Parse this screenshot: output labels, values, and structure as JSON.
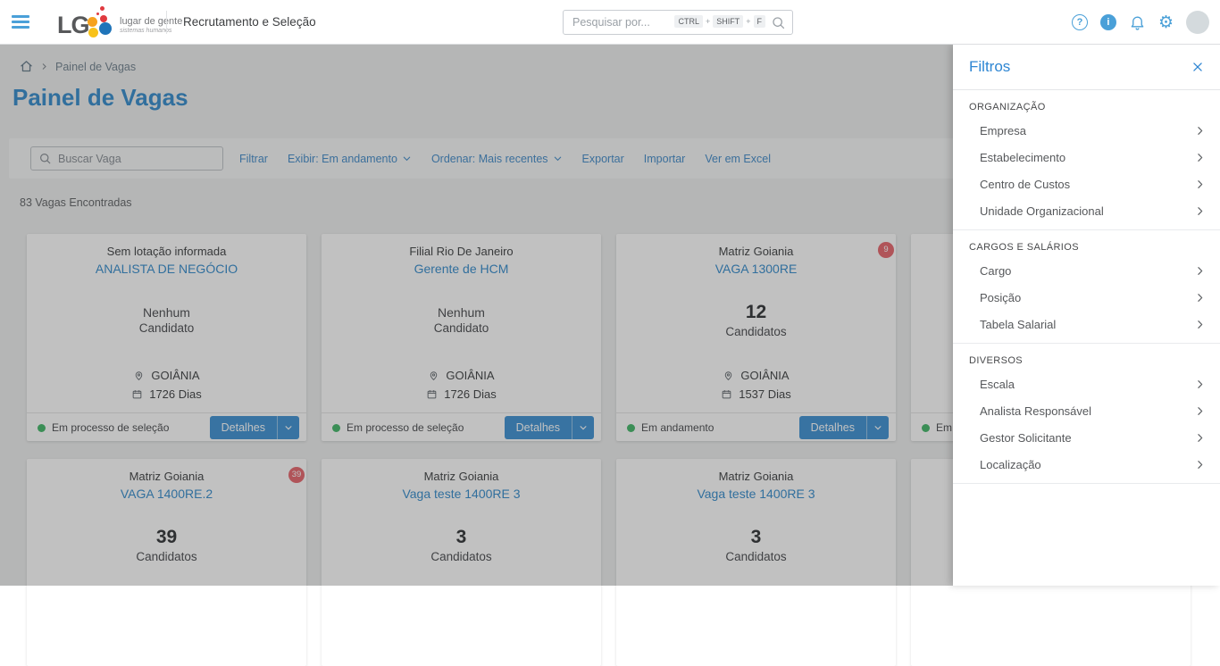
{
  "header": {
    "logo": {
      "lg": "LG",
      "tagline": "lugar de gente",
      "subtitle": "sistemas humanos"
    },
    "app_title": "Recrutamento e Seleção",
    "search": {
      "placeholder": "Pesquisar por...",
      "keys": [
        "CTRL",
        "SHIFT",
        "F"
      ],
      "separator": "+"
    },
    "glyphs": {
      "help": "?",
      "info": "i",
      "gear": "⚙"
    }
  },
  "breadcrumb": {
    "current": "Painel de Vagas"
  },
  "page": {
    "title": "Painel de Vagas",
    "results_count": "83 Vagas Encontradas"
  },
  "toolbar": {
    "search_placeholder": "Buscar Vaga",
    "links": [
      {
        "label": "Filtrar",
        "has_dropdown": false
      },
      {
        "label": "Exibir: Em andamento",
        "has_dropdown": true
      },
      {
        "label": "Ordenar: Mais recentes",
        "has_dropdown": true
      },
      {
        "label": "Exportar",
        "has_dropdown": false
      },
      {
        "label": "Importar",
        "has_dropdown": false
      },
      {
        "label": "Ver em Excel",
        "has_dropdown": false
      }
    ]
  },
  "cards": {
    "details_label": "Detalhes",
    "row1": [
      {
        "unit": "Sem lotação informada",
        "title": "ANALISTA DE NEGÓCIO",
        "badge": "",
        "count_value": "Nenhum",
        "count_label": "Candidato",
        "location": "GOIÂNIA",
        "days": "1726 Dias",
        "status": "Em processo de seleção"
      },
      {
        "unit": "Filial Rio De Janeiro",
        "title": "Gerente de HCM",
        "badge": "",
        "count_value": "Nenhum",
        "count_label": "Candidato",
        "location": "GOIÂNIA",
        "days": "1726 Dias",
        "status": "Em processo de seleção"
      },
      {
        "unit": "Matriz Goiania",
        "title": "VAGA 1300RE",
        "badge": "9",
        "count_value": "12",
        "count_label": "Candidatos",
        "location": "GOIÂNIA",
        "days": "1537 Dias",
        "status": "Em andamento"
      },
      {
        "unit": "",
        "title": "",
        "badge": "",
        "count_value": "",
        "count_label": "",
        "location": "",
        "days": "",
        "status": "Em andamento"
      }
    ],
    "row2": [
      {
        "unit": "Matriz Goiania",
        "title": "VAGA 1400RE.2",
        "badge": "39",
        "count_value": "39",
        "count_label": "Candidatos",
        "location": "",
        "days": "",
        "status": ""
      },
      {
        "unit": "Matriz Goiania",
        "title": "Vaga teste 1400RE 3",
        "badge": "",
        "count_value": "3",
        "count_label": "Candidatos",
        "location": "",
        "days": "",
        "status": ""
      },
      {
        "unit": "Matriz Goiania",
        "title": "Vaga teste 1400RE 3",
        "badge": "",
        "count_value": "3",
        "count_label": "Candidatos",
        "location": "",
        "days": "",
        "status": ""
      },
      {
        "unit": "",
        "title": "",
        "badge": "",
        "count_value": "",
        "count_label": "",
        "location": "",
        "days": "",
        "status": ""
      }
    ]
  },
  "filters_panel": {
    "title": "Filtros",
    "sections": [
      {
        "label": "ORGANIZAÇÃO",
        "items": [
          "Empresa",
          "Estabelecimento",
          "Centro de Custos",
          "Unidade Organizacional"
        ]
      },
      {
        "label": "CARGOS E SALÁRIOS",
        "items": [
          "Cargo",
          "Posição",
          "Tabela Salarial"
        ]
      },
      {
        "label": "DIVERSOS",
        "items": [
          "Escala",
          "Analista Responsável",
          "Gestor Solicitante",
          "Localização"
        ]
      }
    ]
  },
  "colors": {
    "accent_blue": "#4aa0d8",
    "link_blue": "#4f93cd",
    "title_blue": "#4193d0",
    "button_blue": "#4a99d6",
    "filters_blue": "#2e86d3",
    "badge_red": "#e96f76",
    "status_green": "#4fbc72"
  }
}
